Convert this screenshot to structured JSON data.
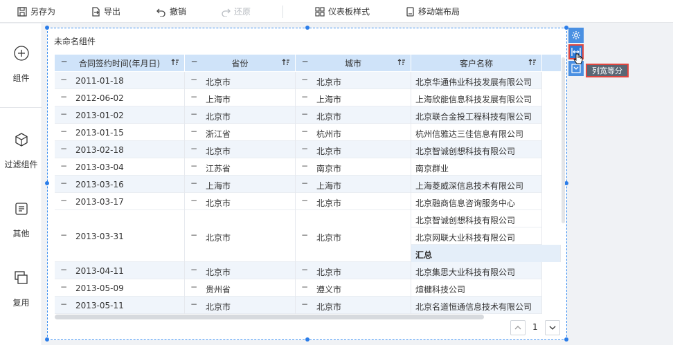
{
  "toolbar": {
    "items": [
      {
        "label": "另存为",
        "icon": "save-icon"
      },
      {
        "label": "导出",
        "icon": "export-icon"
      },
      {
        "label": "撤销",
        "icon": "undo-icon"
      },
      {
        "label": "还原",
        "icon": "redo-icon"
      },
      {
        "label": "仪表板样式",
        "icon": "dashboard-style-icon"
      },
      {
        "label": "移动端布局",
        "icon": "mobile-layout-icon"
      }
    ]
  },
  "sidebar": {
    "items": [
      {
        "label": "组件",
        "icon": "plus-circle-icon"
      },
      {
        "label": "过滤组件",
        "icon": "cube-icon"
      },
      {
        "label": "其他",
        "icon": "document-icon"
      },
      {
        "label": "复用",
        "icon": "copy-icon"
      }
    ]
  },
  "widget": {
    "title": "未命名组件",
    "columns": [
      "合同签约时间(年月日)",
      "省份",
      "城市",
      "客户名称"
    ],
    "rows": [
      {
        "date": "2011-01-18",
        "province": "北京市",
        "city": "北京市",
        "customer": "北京华通伟业科技发展有限公司"
      },
      {
        "date": "2012-06-02",
        "province": "上海市",
        "city": "上海市",
        "customer": "上海欣能信息科技发展有限公司"
      },
      {
        "date": "2013-01-02",
        "province": "北京市",
        "city": "北京市",
        "customer": "北京联合金投工程科技有限公司"
      },
      {
        "date": "2013-01-15",
        "province": "浙江省",
        "city": "杭州市",
        "customer": "杭州信雅达三佳信息有限公司"
      },
      {
        "date": "2013-02-18",
        "province": "北京市",
        "city": "北京市",
        "customer": "北京智诚创想科技有限公司"
      },
      {
        "date": "2013-03-04",
        "province": "江苏省",
        "city": "南京市",
        "customer": "南京群业"
      },
      {
        "date": "2013-03-16",
        "province": "上海市",
        "city": "上海市",
        "customer": "上海菱威深信息技术有限公司"
      },
      {
        "date": "2013-03-17",
        "province": "北京市",
        "city": "北京市",
        "customer": "北京融商信息咨询服务中心"
      },
      {
        "date": "2013-03-31",
        "province": "北京市",
        "city": "北京市",
        "customers": [
          "北京智诚创想科技有限公司",
          "北京网联大业科技有限公司"
        ],
        "subtotal": "汇总"
      },
      {
        "date": "2013-04-11",
        "province": "北京市",
        "city": "北京市",
        "customer": "北京集思大业科技有限公司"
      },
      {
        "date": "2013-05-09",
        "province": "贵州省",
        "city": "遵义市",
        "customer": "煊楗科技公司"
      },
      {
        "date": "2013-05-11",
        "province": "北京市",
        "city": "北京市",
        "customer": "北京名道恒通信息技术有限公司"
      }
    ],
    "collapse_symbol": "−",
    "page": "1"
  },
  "tools": {
    "tooltip": "列宽等分"
  },
  "colors": {
    "accent": "#2b7de9",
    "header": "#cfe3f9",
    "highlight": "#e0463f"
  }
}
